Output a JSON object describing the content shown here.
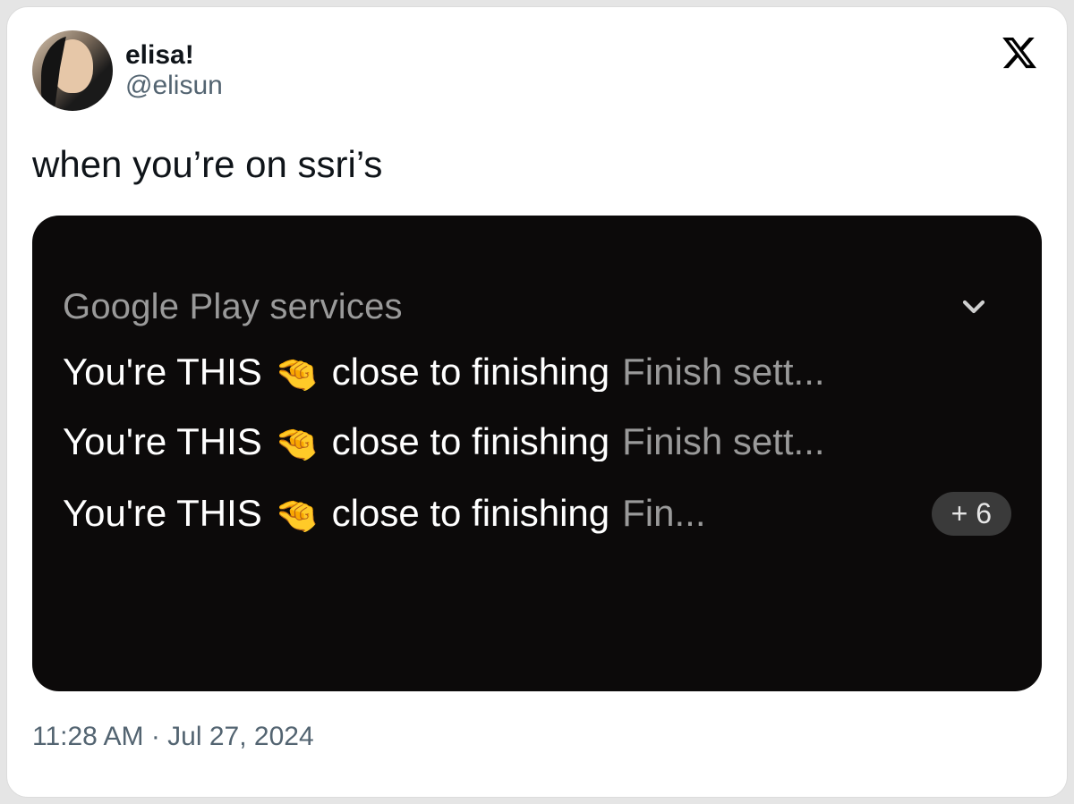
{
  "author": {
    "display_name": "elisa!",
    "handle": "@elisun"
  },
  "tweet_text": "when you’re on ssri’s",
  "embedded_notification": {
    "app_name": "Google Play services",
    "emoji": "🤏",
    "rows": [
      {
        "title_a": "You're THIS",
        "title_b": "close to finishing",
        "sub": "Finish sett..."
      },
      {
        "title_a": "You're THIS",
        "title_b": "close to finishing",
        "sub": "Finish sett..."
      },
      {
        "title_a": "You're THIS",
        "title_b": "close to finishing",
        "sub": "Fin..."
      }
    ],
    "more_count": "+ 6"
  },
  "timestamp": "11:28 AM · Jul 27, 2024"
}
